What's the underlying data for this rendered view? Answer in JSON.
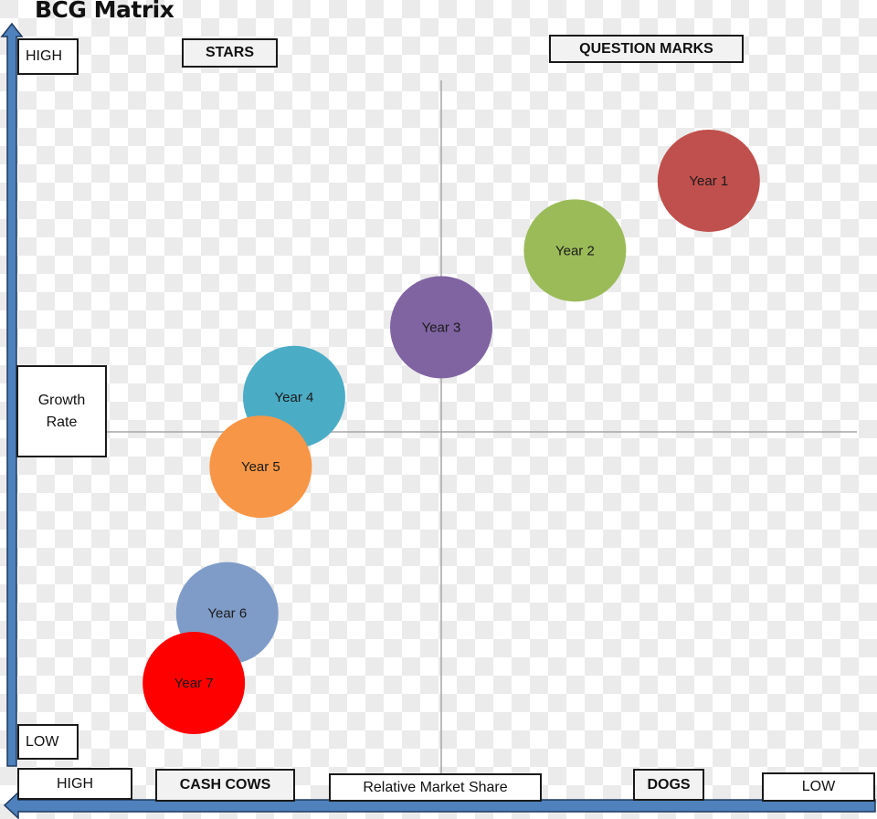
{
  "title": "BCG Matrix",
  "axes": {
    "y_high": "HIGH",
    "y_low": "LOW",
    "y_label_line1": "Growth",
    "y_label_line2": "Rate",
    "x_high": "HIGH",
    "x_low": "LOW",
    "x_label": "Relative Market Share"
  },
  "quadrants": {
    "top_left": "STARS",
    "top_right": "QUESTION MARKS",
    "bottom_left": "CASH COWS",
    "bottom_right": "DOGS"
  },
  "colors": {
    "axis_arrow": "#4f81bd",
    "divider": "#a6a6a6"
  },
  "chart_data": {
    "type": "scatter",
    "title": "BCG Matrix",
    "xlabel": "Relative Market Share",
    "ylabel": "Growth Rate",
    "x_direction": "high-to-low (left = HIGH, right = LOW)",
    "y_direction": "low-to-high (bottom = LOW, top = HIGH)",
    "xlim": [
      0,
      100
    ],
    "ylim": [
      0,
      100
    ],
    "divider_x": 50,
    "divider_y": 50,
    "points": [
      {
        "label": "Year 1",
        "x": 90,
        "y": 86,
        "color": "#c0504d"
      },
      {
        "label": "Year 2",
        "x": 70,
        "y": 76,
        "color": "#9bbb59"
      },
      {
        "label": "Year 3",
        "x": 50,
        "y": 65,
        "color": "#8064a2"
      },
      {
        "label": "Year 4",
        "x": 28,
        "y": 55,
        "color": "#4bacc6"
      },
      {
        "label": "Year 5",
        "x": 23,
        "y": 45,
        "color": "#f79646"
      },
      {
        "label": "Year 6",
        "x": 18,
        "y": 24,
        "color": "#7f9cc8"
      },
      {
        "label": "Year 7",
        "x": 13,
        "y": 14,
        "color": "#ff0000"
      }
    ]
  }
}
